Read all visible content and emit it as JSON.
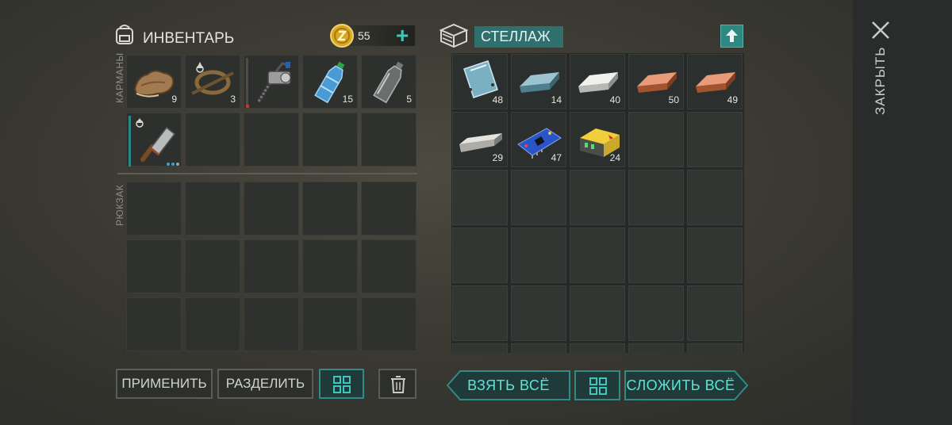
{
  "inventory": {
    "title": "ИНВЕНТАРЬ",
    "coins": "55",
    "plus": "+",
    "pockets_label": "КАРМАНЫ",
    "backpack_label": "РЮКЗАК",
    "pockets": [
      {
        "name": "leather",
        "count": "9"
      },
      {
        "name": "rope-trap",
        "count": "3"
      },
      {
        "name": "hand-drill",
        "count": ""
      },
      {
        "name": "water-bottle",
        "count": "15"
      },
      {
        "name": "empty-bottle",
        "count": "5"
      },
      {
        "name": "cleaver",
        "count": ""
      }
    ]
  },
  "chest": {
    "title": "СТЕЛЛАЖ",
    "items": [
      {
        "name": "glass-sheet",
        "count": "48"
      },
      {
        "name": "steel-ingot",
        "count": "14"
      },
      {
        "name": "aluminum-ingot",
        "count": "40"
      },
      {
        "name": "copper-ingot",
        "count": "50"
      },
      {
        "name": "copper-ingot",
        "count": "49"
      },
      {
        "name": "metal-bar",
        "count": "29"
      },
      {
        "name": "circuit-board",
        "count": "47"
      },
      {
        "name": "battery",
        "count": "24"
      }
    ]
  },
  "actions": {
    "use": "ПРИМЕНИТЬ",
    "split": "РАЗДЕЛИТЬ",
    "take_all": "ВЗЯТЬ ВСЁ",
    "put_all": "СЛОЖИТЬ ВСЁ"
  },
  "close_label": "ЗАКРЫТЬ",
  "colors": {
    "accent": "#3fc6bd",
    "panel": "#2d302d"
  }
}
